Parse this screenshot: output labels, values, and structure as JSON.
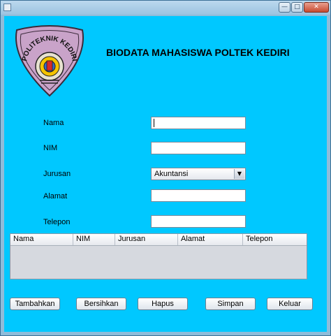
{
  "window": {
    "title": ""
  },
  "form": {
    "heading": "BIODATA MAHASISWA POLTEK KEDIRI",
    "logo_text": "POLITEKNIK KEDIRI",
    "labels": {
      "nama": "Nama",
      "nim": "NIM",
      "jurusan": "Jurusan",
      "alamat": "Alamat",
      "telepon": "Telepon"
    },
    "values": {
      "nama": "",
      "nim": "",
      "jurusan": "Akuntansi",
      "alamat": "",
      "telepon": ""
    }
  },
  "table": {
    "columns": [
      "Nama",
      "NIM",
      "Jurusan",
      "Alamat",
      "Telepon"
    ],
    "rows": []
  },
  "buttons": {
    "tambahkan": "Tambahkan",
    "bersihkan": "Bersihkan",
    "hapus": "Hapus",
    "simpan": "Simpan",
    "keluar": "Keluar"
  },
  "colors": {
    "background": "#00c8ff",
    "logo_fill": "#c9a3c9"
  },
  "icons": {
    "minimize": "minimize-icon",
    "maximize": "maximize-icon",
    "close": "close-icon",
    "dropdown": "chevron-down-icon"
  }
}
